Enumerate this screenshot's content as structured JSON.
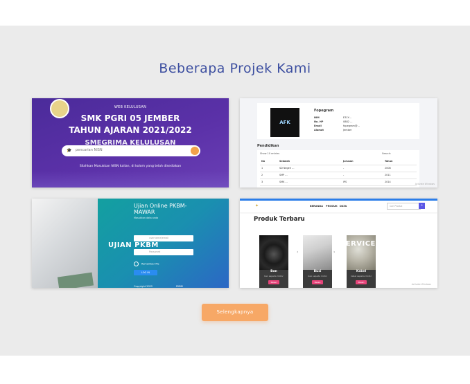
{
  "section": {
    "title": "Beberapa Projek Kami",
    "more_label": "Selengkapnya"
  },
  "colors": {
    "title": "#3d4fa0",
    "button": "#f7a866",
    "background": "#ebebeb"
  },
  "cards": [
    {
      "web": "WEB KELULUSAN",
      "heading1": "SMK PGRI 05 JEMBER",
      "heading2": "TAHUN AJARAN 2021/2022",
      "heading3": "SMEGRIMA KELULUSAN",
      "search_placeholder": "pencarian NISN",
      "hint": "Silahkan Masukkan NISN kalian, di kolom yang telah disediakan"
    },
    {
      "avatar": "AFK",
      "name": "Fopegram",
      "fields": [
        {
          "k": "NIM",
          "v": "E31Y…"
        },
        {
          "k": "No. HP",
          "v": "0882 …"
        },
        {
          "k": "Email",
          "v": "fopegram@…"
        },
        {
          "k": "Alamat",
          "v": "Jember"
        }
      ],
      "section": "Pendidikan",
      "show": "Show 10 entries",
      "search": "Search:",
      "columns": [
        "No",
        "Sekolah",
        "Jurusan",
        "Tahun"
      ],
      "rows": [
        [
          "1",
          "SD Negeri …",
          "-",
          "2008"
        ],
        [
          "2",
          "SMP …",
          "-",
          "2011"
        ],
        [
          "3",
          "SMK …",
          "IPS",
          "2014"
        ]
      ],
      "watermark": "Activate Windows"
    },
    {
      "title": "Ujian Online PKBM-MAWAR",
      "subtitle": "Masukkan data anda",
      "big": "UJIAN PKBM",
      "username": "username/email",
      "password": "Password",
      "remember": "Remember Me",
      "login": "LOG IN",
      "foot_left": "Copyright 2022",
      "foot_right": "PKBM"
    },
    {
      "nav": [
        "BERANDA",
        "PRODUK",
        "DATA"
      ],
      "search": "Cari Produk",
      "section": "Produk Terbaru",
      "service": "SERVICE",
      "products": [
        {
          "name": "Ban",
          "desc": "ban sepeda motor",
          "btn": "Pesan"
        },
        {
          "name": "Busi",
          "desc": "busi sepeda motor",
          "btn": "Pesan"
        },
        {
          "name": "Kabel",
          "desc": "kabel sepeda motor",
          "btn": "Pesan"
        }
      ],
      "watermark": "Activate Windows"
    }
  ]
}
